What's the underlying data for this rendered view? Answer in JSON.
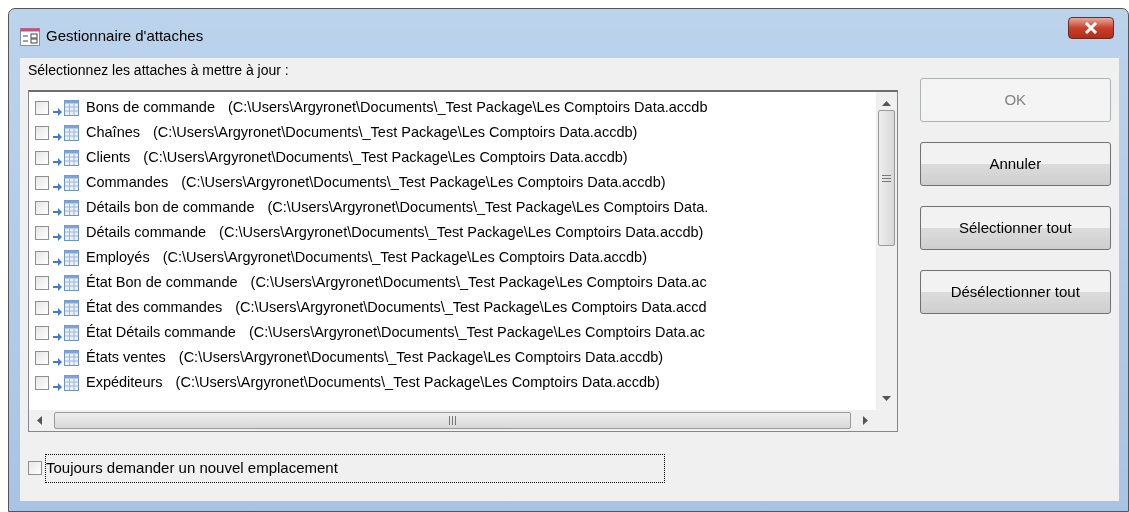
{
  "window": {
    "title": "Gestionnaire d'attaches"
  },
  "prompt": "Sélectionnez les attaches à mettre à jour :",
  "links": [
    {
      "name": "Bons de commande",
      "path": "(C:\\Users\\Argyronet\\Documents\\_Test Package\\Les Comptoirs Data.accdb",
      "checked": false
    },
    {
      "name": "Chaînes",
      "path": "(C:\\Users\\Argyronet\\Documents\\_Test Package\\Les Comptoirs Data.accdb)",
      "checked": false
    },
    {
      "name": "Clients",
      "path": "(C:\\Users\\Argyronet\\Documents\\_Test Package\\Les Comptoirs Data.accdb)",
      "checked": false
    },
    {
      "name": "Commandes",
      "path": "(C:\\Users\\Argyronet\\Documents\\_Test Package\\Les Comptoirs Data.accdb)",
      "checked": false
    },
    {
      "name": "Détails bon de commande",
      "path": "(C:\\Users\\Argyronet\\Documents\\_Test Package\\Les Comptoirs Data.",
      "checked": false
    },
    {
      "name": "Détails commande",
      "path": "(C:\\Users\\Argyronet\\Documents\\_Test Package\\Les Comptoirs Data.accdb)",
      "checked": false
    },
    {
      "name": "Employés",
      "path": "(C:\\Users\\Argyronet\\Documents\\_Test Package\\Les Comptoirs Data.accdb)",
      "checked": false
    },
    {
      "name": "État Bon de commande",
      "path": "(C:\\Users\\Argyronet\\Documents\\_Test Package\\Les Comptoirs Data.ac",
      "checked": false
    },
    {
      "name": "État des commandes",
      "path": "(C:\\Users\\Argyronet\\Documents\\_Test Package\\Les Comptoirs Data.accd",
      "checked": false
    },
    {
      "name": "État Détails commande",
      "path": "(C:\\Users\\Argyronet\\Documents\\_Test Package\\Les Comptoirs Data.ac",
      "checked": false
    },
    {
      "name": "États ventes",
      "path": "(C:\\Users\\Argyronet\\Documents\\_Test Package\\Les Comptoirs Data.accdb)",
      "checked": false
    },
    {
      "name": "Expéditeurs",
      "path": "(C:\\Users\\Argyronet\\Documents\\_Test Package\\Les Comptoirs Data.accdb)",
      "checked": false
    }
  ],
  "buttons": [
    {
      "label": "OK",
      "disabled": true
    },
    {
      "label": "Annuler",
      "disabled": false
    },
    {
      "label": "Sélectionner tout",
      "disabled": false
    },
    {
      "label": "Désélectionner tout",
      "disabled": false
    }
  ],
  "always_ask": {
    "label": "Toujours demander un nouvel emplacement",
    "checked": false
  }
}
